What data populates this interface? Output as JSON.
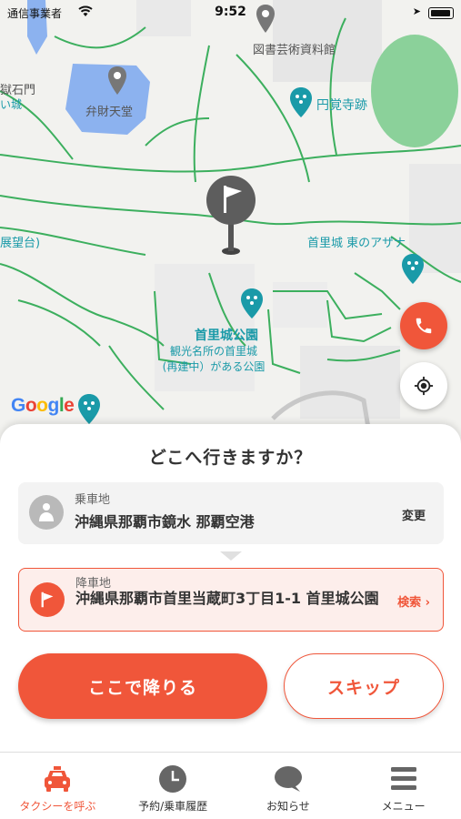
{
  "status_bar": {
    "carrier": "通信事業者",
    "time": "9:52"
  },
  "map": {
    "labels": {
      "library": "図書芸術資料館",
      "benzaiten": "弁財天堂",
      "enkakuji": "円覚寺跡",
      "shureimon_left": "獄石門",
      "castle_left": "い城",
      "observatory": "展望台)",
      "azana": "首里城 東のアザナ",
      "park": "首里城公園",
      "park_desc_1": "観光名所の首里城",
      "park_desc_2": "(再建中）がある公園"
    },
    "google_logo": [
      "G",
      "o",
      "o",
      "g",
      "l",
      "e"
    ]
  },
  "sheet": {
    "title": "どこへ行きますか？",
    "pickup": {
      "label": "乗車地",
      "value": "沖縄県那覇市鏡水  那覇空港",
      "action": "変更",
      "icon": "person-icon"
    },
    "dropoff": {
      "label": "降車地",
      "value": "沖縄県那覇市首里当蔵町3丁目1-1  首里城公園",
      "action": "検索 ›",
      "icon": "flag-icon"
    },
    "primary_button": "ここで降りる",
    "secondary_button": "スキップ"
  },
  "tabs": [
    {
      "label": "タクシーを呼ぶ",
      "icon": "taxi-icon",
      "active": true
    },
    {
      "label": "予約/乗車履歴",
      "icon": "clock-icon",
      "active": false
    },
    {
      "label": "お知らせ",
      "icon": "chat-bubble-icon",
      "active": false
    },
    {
      "label": "メニュー",
      "icon": "menu-icon",
      "active": false
    }
  ],
  "colors": {
    "accent": "#f0563a",
    "teal": "#1a9aa8",
    "path_green": "#3caf5e"
  }
}
